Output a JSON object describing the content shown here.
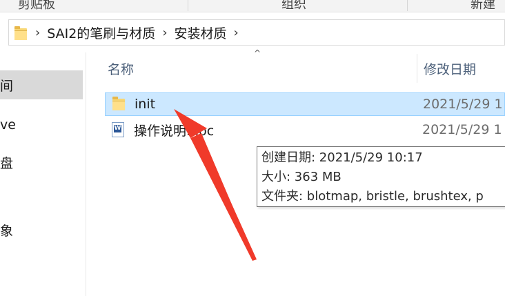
{
  "ribbon": {
    "groups": [
      "剪贴板",
      "组织",
      "新建"
    ]
  },
  "address": {
    "crumbs": [
      "SAI2的笔刷与材质",
      "安装材质"
    ],
    "separator": "›"
  },
  "nav": {
    "items": [
      "间",
      "ve",
      "盘",
      "象"
    ]
  },
  "columns": {
    "name": "名称",
    "date": "修改日期",
    "sort_glyph": "^"
  },
  "files": [
    {
      "name": "init",
      "type": "folder",
      "date": "2021/5/29 1"
    },
    {
      "name": "操作说明.doc",
      "type": "doc",
      "date": "2021/5/29 1"
    }
  ],
  "tooltip": {
    "created": "创建日期: 2021/5/29 10:17",
    "size": "大小: 363 MB",
    "contents": "文件夹: blotmap, bristle, brushtex, p"
  },
  "colors": {
    "selection": "#cce8ff",
    "selection_border": "#99d1ff",
    "arrow": "#f03a2a",
    "header_text": "#4c607a"
  }
}
